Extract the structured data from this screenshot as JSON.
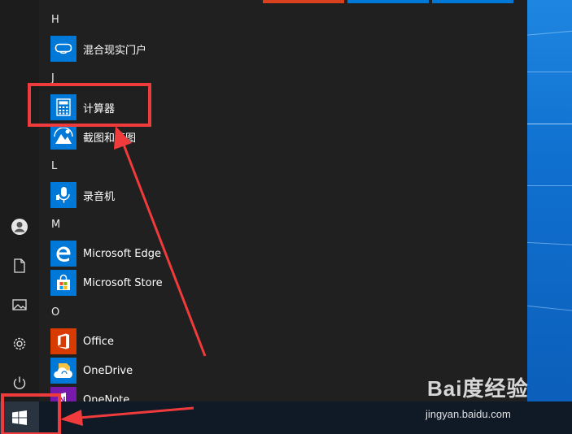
{
  "start_menu": {
    "sections": [
      {
        "letter": "H",
        "apps": [
          {
            "label": "混合现实门户",
            "icon": "mixed-reality-icon"
          }
        ]
      },
      {
        "letter": "J",
        "apps": [
          {
            "label": "计算器",
            "icon": "calculator-icon"
          },
          {
            "label": "截图和草图",
            "icon": "snip-sketch-icon"
          }
        ]
      },
      {
        "letter": "L",
        "apps": [
          {
            "label": "录音机",
            "icon": "voice-recorder-icon"
          }
        ]
      },
      {
        "letter": "M",
        "apps": [
          {
            "label": "Microsoft Edge",
            "icon": "edge-icon"
          },
          {
            "label": "Microsoft Store",
            "icon": "store-icon"
          }
        ]
      },
      {
        "letter": "O",
        "apps": [
          {
            "label": "Office",
            "icon": "office-icon"
          },
          {
            "label": "OneDrive",
            "icon": "onedrive-icon"
          },
          {
            "label": "OneNote",
            "icon": "onenote-icon"
          }
        ]
      }
    ]
  },
  "left_rail": [
    "user-icon",
    "document-icon",
    "pictures-icon",
    "settings-icon",
    "power-icon"
  ],
  "watermark": {
    "brand": "Bai度经验",
    "url": "jingyan.baidu.com"
  },
  "colors": {
    "accent": "#0078d7",
    "office": "#d83b01",
    "onenote": "#7719aa",
    "annotation": "#ef3b3b",
    "tile_red": "#d9411e"
  }
}
